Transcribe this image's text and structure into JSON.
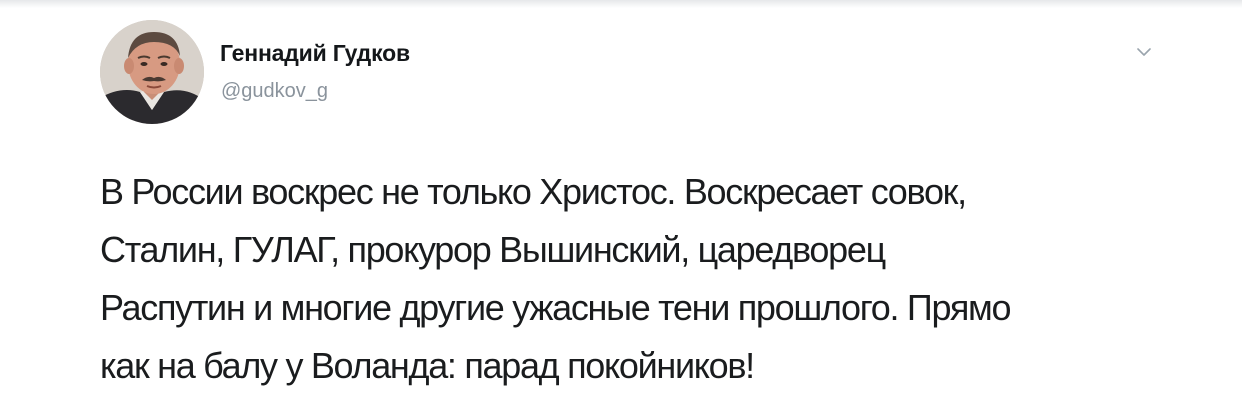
{
  "tweet": {
    "author_name": "Геннадий Гудков",
    "author_handle": "@gudkov_g",
    "text": "В России воскрес не только Христос. Воскресает совок,\nСталин, ГУЛАГ, прокурор Вышинский, царедворец\nРаспутин и многие другие ужасные тени прошлого. Прямо\nкак на балу у Воланда: парад покойников!",
    "menu_icon": "chevron-down-icon",
    "avatar_icon": "avatar-photo"
  },
  "colors": {
    "text": "#14171a",
    "secondary_text": "#8a939c",
    "background": "#ffffff"
  }
}
